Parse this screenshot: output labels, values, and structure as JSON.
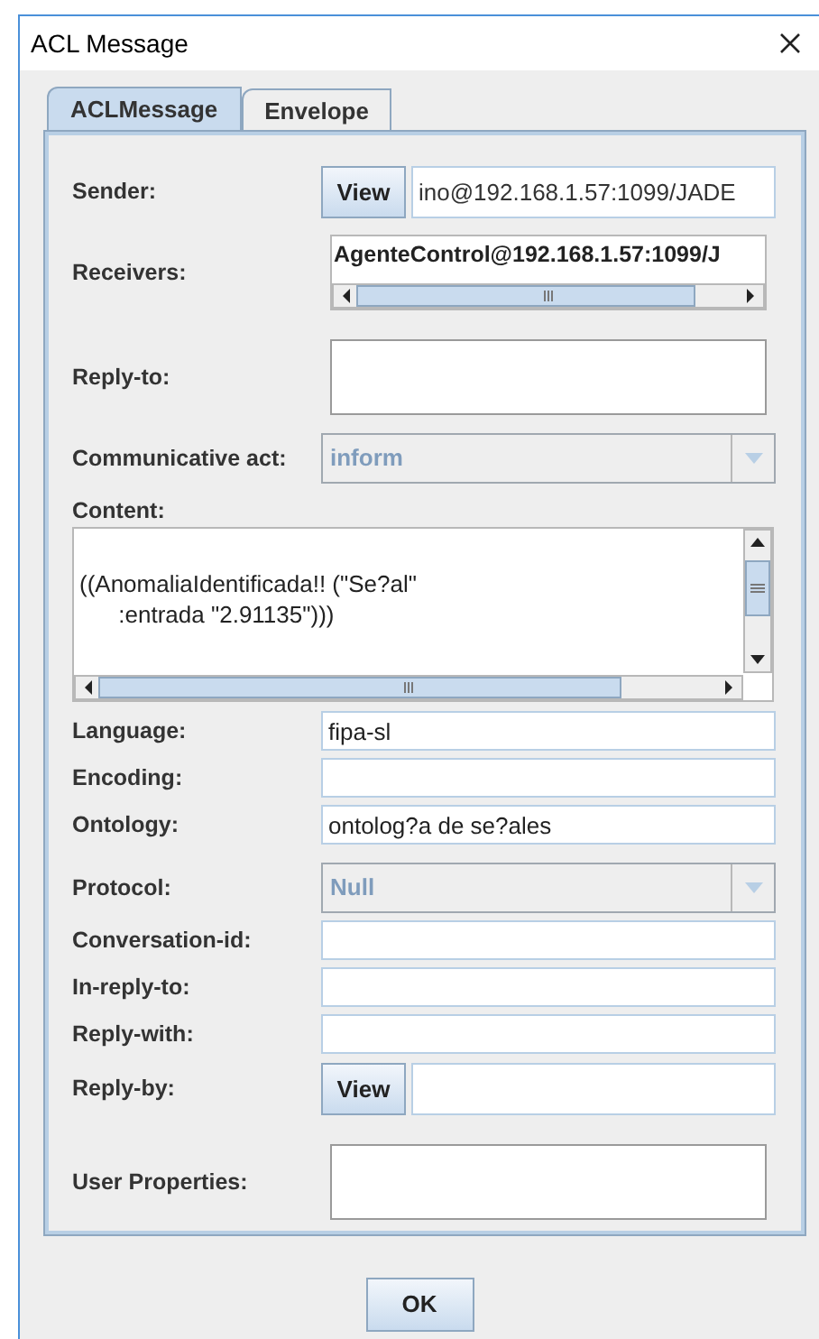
{
  "window": {
    "title": "ACL Message"
  },
  "tabs": [
    {
      "label": "ACLMessage",
      "selected": true
    },
    {
      "label": "Envelope",
      "selected": false
    }
  ],
  "fields": [
    {
      "kind": "view_field",
      "label": "Sender:",
      "button": "View",
      "value": "ino@192.168.1.57:1099/JADE"
    },
    {
      "kind": "list",
      "label": "Receivers:",
      "items": [
        "AgenteControl@192.168.1.57:1099/J"
      ]
    },
    {
      "kind": "box",
      "label": "Reply-to:"
    },
    {
      "kind": "combo",
      "label": "Communicative act:",
      "value": "inform",
      "disabled": true
    },
    {
      "kind": "textarea",
      "label": "Content:",
      "value": "\n((AnomaliaIdentificada!! (\"Se?al\"\n      :entrada \"2.91135\")))"
    },
    {
      "kind": "text",
      "label": "Language:",
      "value": "fipa-sl"
    },
    {
      "kind": "text",
      "label": "Encoding:"
    },
    {
      "kind": "text",
      "label": "Ontology:",
      "value": "ontolog?a de se?ales"
    },
    {
      "kind": "combo",
      "label": "Protocol:",
      "value": "Null",
      "disabled": true
    },
    {
      "kind": "text",
      "label": "Conversation-id:"
    },
    {
      "kind": "text",
      "label": "In-reply-to:"
    },
    {
      "kind": "text",
      "label": "Reply-with:"
    },
    {
      "kind": "view_field",
      "label": "Reply-by:",
      "button": "View"
    },
    {
      "kind": "box",
      "label": "User Properties:"
    }
  ],
  "buttons": [
    "OK"
  ]
}
